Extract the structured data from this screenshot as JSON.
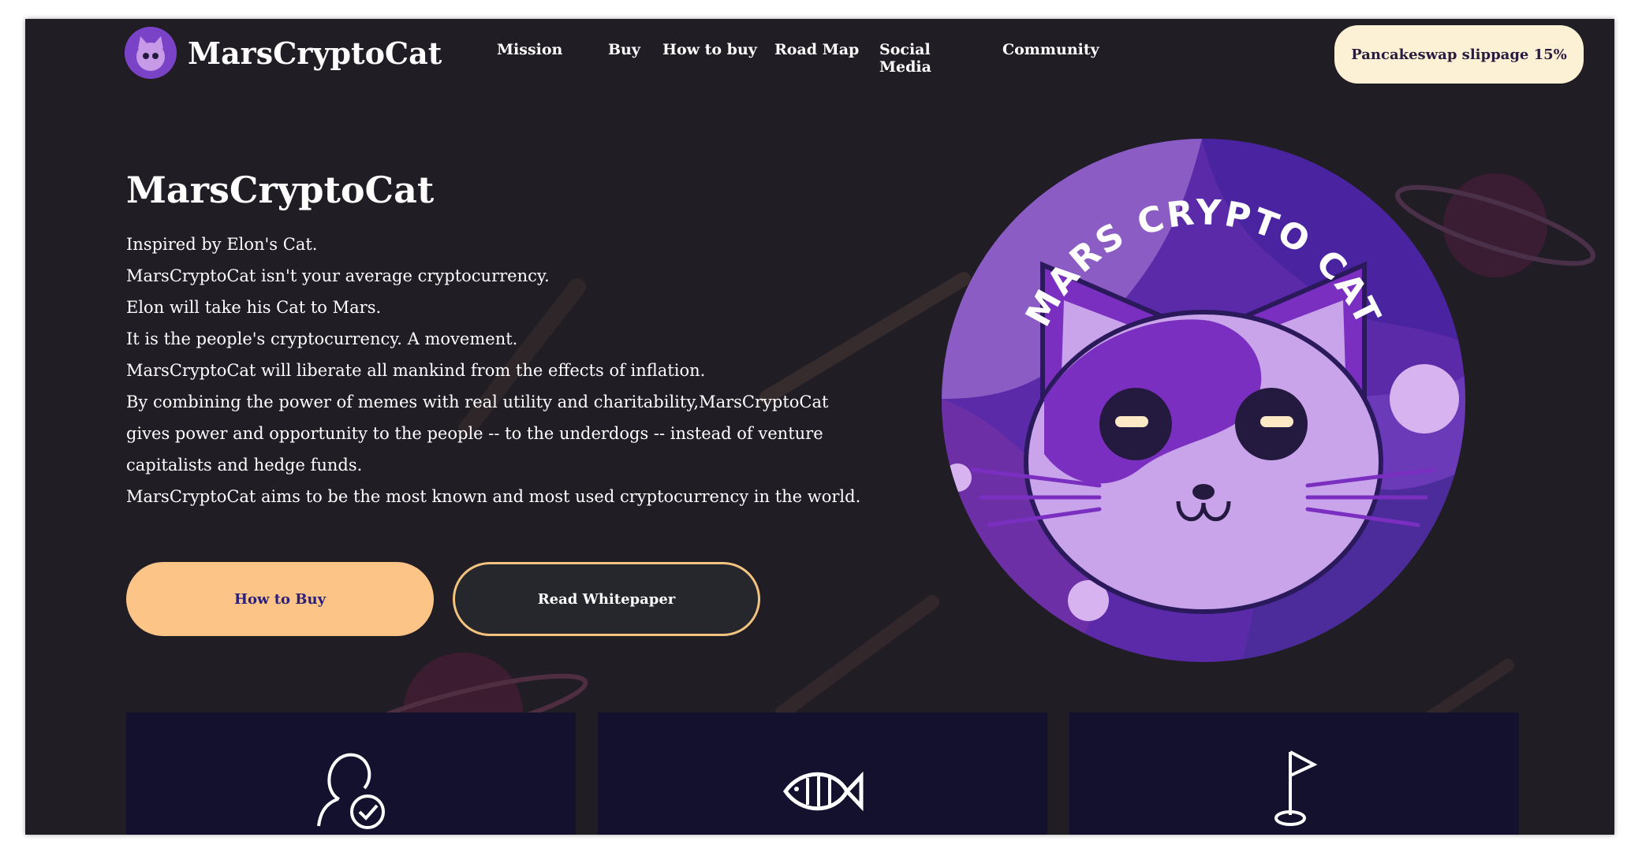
{
  "header": {
    "brand": "MarsCryptoCat",
    "nav": [
      "Mission",
      "Buy",
      "How to buy",
      "Road Map",
      "Social Media",
      "Community"
    ],
    "slippage_button": "Pancakeswap slippage 15%"
  },
  "hero": {
    "title": "MarsCryptoCat",
    "lines": [
      "Inspired by Elon's Cat.",
      "MarsCryptoCat isn't your average cryptocurrency.",
      "Elon will take his Cat to Mars.",
      "It is the people's cryptocurrency. A movement.",
      "MarsCryptoCat will liberate all mankind from the effects of inflation.",
      "By combining the power of memes with real utility and charitability,MarsCryptoCat",
      "gives power and opportunity to the people -- to the underdogs -- instead of venture",
      "capitalists and hedge funds.",
      "MarsCryptoCat aims to be the most known and most used cryptocurrency in the world."
    ],
    "buy_button": "How to Buy",
    "whitepaper_button": "Read Whitepaper",
    "emblem_text": "MARS CRYPTO CAT"
  },
  "cards": [
    {
      "icon": "user-check-icon"
    },
    {
      "icon": "fish-icon"
    },
    {
      "icon": "flag-icon"
    }
  ],
  "colors": {
    "background": "#201d24",
    "accent_orange": "#fcc587",
    "accent_cream": "#fdf1d5",
    "card_bg": "#14112e",
    "purple": "#7a43c7"
  }
}
